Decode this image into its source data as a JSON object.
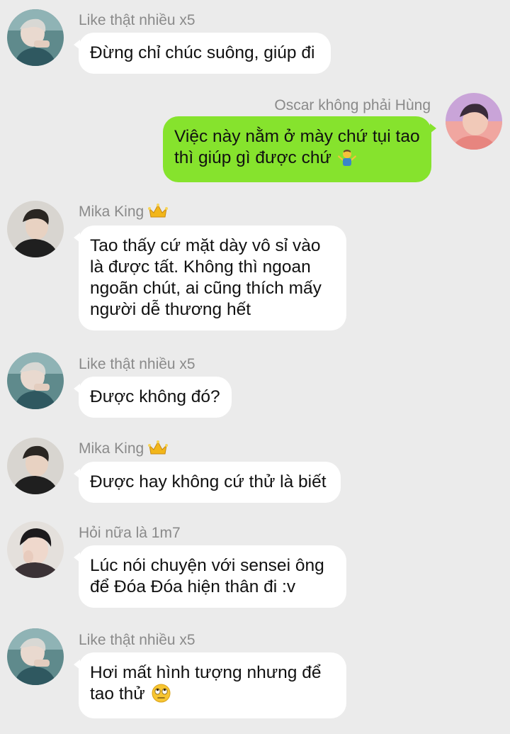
{
  "messages": [
    {
      "sender": "Like thật nhiều x5",
      "text": "Đừng chỉ chúc suông, giúp đi",
      "emoji": ""
    },
    {
      "sender": "Oscar không phải Hùng",
      "text": "Việc này nằm ở mày chứ tụi tao thì giúp gì được chứ",
      "emoji": "🤷‍♂️",
      "emoji_name": "person-shrugging-emoji"
    },
    {
      "sender": "Mika King",
      "text": "Tao thấy cứ mặt dày vô sỉ vào là được tất. Không thì ngoan ngoãn chút, ai cũng thích mấy người dễ thương hết",
      "emoji": "",
      "badge": "crown-icon"
    },
    {
      "sender": "Like thật nhiều x5",
      "text": "Được không đó?",
      "emoji": ""
    },
    {
      "sender": "Mika King",
      "text": "Được hay không cứ thử là biết",
      "emoji": "",
      "badge": "crown-icon"
    },
    {
      "sender": "Hỏi nữa là 1m7",
      "text": "Lúc nói chuyện với sensei ông để Đóa Đóa hiện thân đi :v",
      "emoji": ""
    },
    {
      "sender": "Like thật nhiều x5",
      "text": "Hơi mất hình tượng nhưng để tao thử",
      "emoji": "🙄",
      "emoji_name": "face-with-rolling-eyes-emoji"
    }
  ],
  "colors": {
    "background": "#ebebeb",
    "incoming_bubble": "#ffffff",
    "outgoing_bubble": "#86e32d",
    "sender_name": "#8a8a8a",
    "crown": "#f2b61a"
  }
}
